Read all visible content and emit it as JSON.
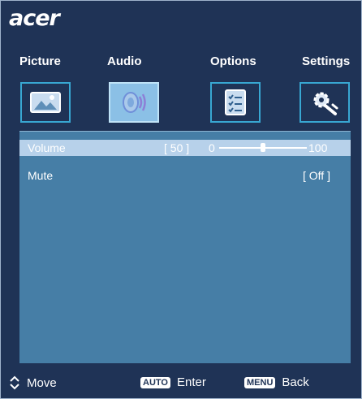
{
  "brand": "acer",
  "tabs": [
    {
      "label": "Picture"
    },
    {
      "label": "Audio"
    },
    {
      "label": "Options"
    },
    {
      "label": "Settings"
    }
  ],
  "icons": [
    {
      "name": "picture-icon"
    },
    {
      "name": "audio-icon"
    },
    {
      "name": "options-icon"
    },
    {
      "name": "settings-icon"
    }
  ],
  "menu": {
    "volume": {
      "label": "Volume",
      "value": "[ 50 ]",
      "min": "0",
      "max": "100",
      "level": 50
    },
    "mute": {
      "label": "Mute",
      "value": "[ Off ]"
    }
  },
  "footer": {
    "move_label": "Move",
    "auto_key": "AUTO",
    "enter_label": "Enter",
    "menu_key": "MENU",
    "back_label": "Back"
  }
}
